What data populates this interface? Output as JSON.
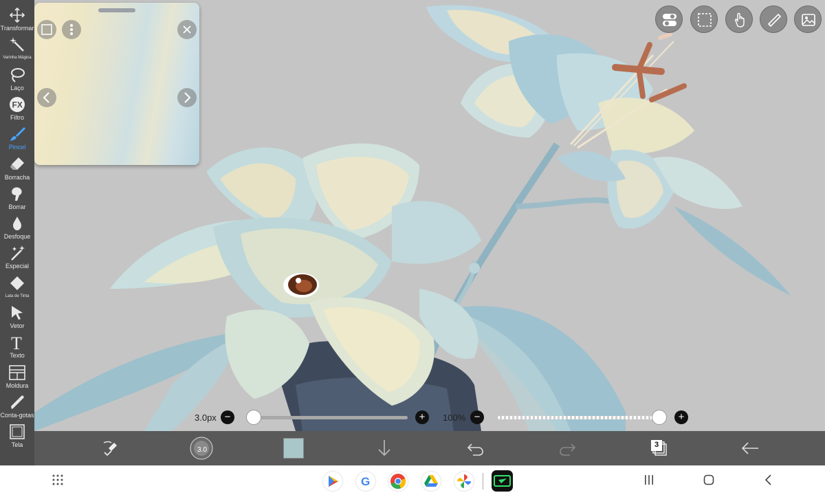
{
  "tools": [
    {
      "id": "transform",
      "label": "Transformar",
      "icon": "move-arrows-icon"
    },
    {
      "id": "magic-wand",
      "label": "Varinha Mágica",
      "icon": "magic-wand-icon"
    },
    {
      "id": "lasso",
      "label": "Laço",
      "icon": "lasso-icon"
    },
    {
      "id": "filter",
      "label": "Filtro",
      "icon": "fx-icon",
      "glyph": "FX"
    },
    {
      "id": "brush",
      "label": "Pincel",
      "icon": "brush-icon",
      "active": true
    },
    {
      "id": "eraser",
      "label": "Borracha",
      "icon": "eraser-icon"
    },
    {
      "id": "smudge",
      "label": "Borrar",
      "icon": "smudge-icon"
    },
    {
      "id": "blur",
      "label": "Desfoque",
      "icon": "drop-icon"
    },
    {
      "id": "special",
      "label": "Especial",
      "icon": "sparkle-brush-icon"
    },
    {
      "id": "bucket",
      "label": "Lata de Tinta",
      "icon": "paint-bucket-icon"
    },
    {
      "id": "vector",
      "label": "Vetor",
      "icon": "cursor-arrow-icon"
    },
    {
      "id": "text",
      "label": "Texto",
      "icon": "text-icon",
      "glyph": "T"
    },
    {
      "id": "frame",
      "label": "Moldura",
      "icon": "frame-icon"
    },
    {
      "id": "eyedropper",
      "label": "Conta-gotas",
      "icon": "eyedropper-icon"
    },
    {
      "id": "canvas",
      "label": "Tela",
      "icon": "canvas-icon"
    }
  ],
  "brush": {
    "size_label": "3.0px",
    "size_fraction": 0.0,
    "opacity_label": "100%",
    "opacity_fraction": 1.0,
    "size_badge": "3.0"
  },
  "colors": {
    "toolbar": "#4b4b4b",
    "active": "#4aa3ff",
    "current_color": "#a9c6c8",
    "canvas_bg": "#c5c5c5"
  },
  "layers": {
    "count": "3"
  },
  "reference_panel": {
    "icons": [
      "crop-icon",
      "more-vertical-icon",
      "close-icon",
      "chevron-left-icon",
      "chevron-right-icon"
    ]
  },
  "top_buttons": [
    "toggle-settings-icon",
    "selection-icon",
    "hand-touch-icon",
    "ruler-icon",
    "image-icon"
  ],
  "bottom_buttons": [
    "transform-eraser-icon",
    "brush-size-preview",
    "current-color-swatch",
    "download-arrow-icon",
    "undo-icon",
    "redo-icon",
    "layers-icon",
    "back-arrow-icon"
  ],
  "dock": [
    "play-store-icon",
    "google-icon",
    "chrome-icon",
    "drive-icon",
    "photos-icon",
    "ibis-paint-icon"
  ],
  "nav_buttons": [
    "app-drawer-icon",
    "recents-icon",
    "home-icon",
    "back-icon"
  ]
}
